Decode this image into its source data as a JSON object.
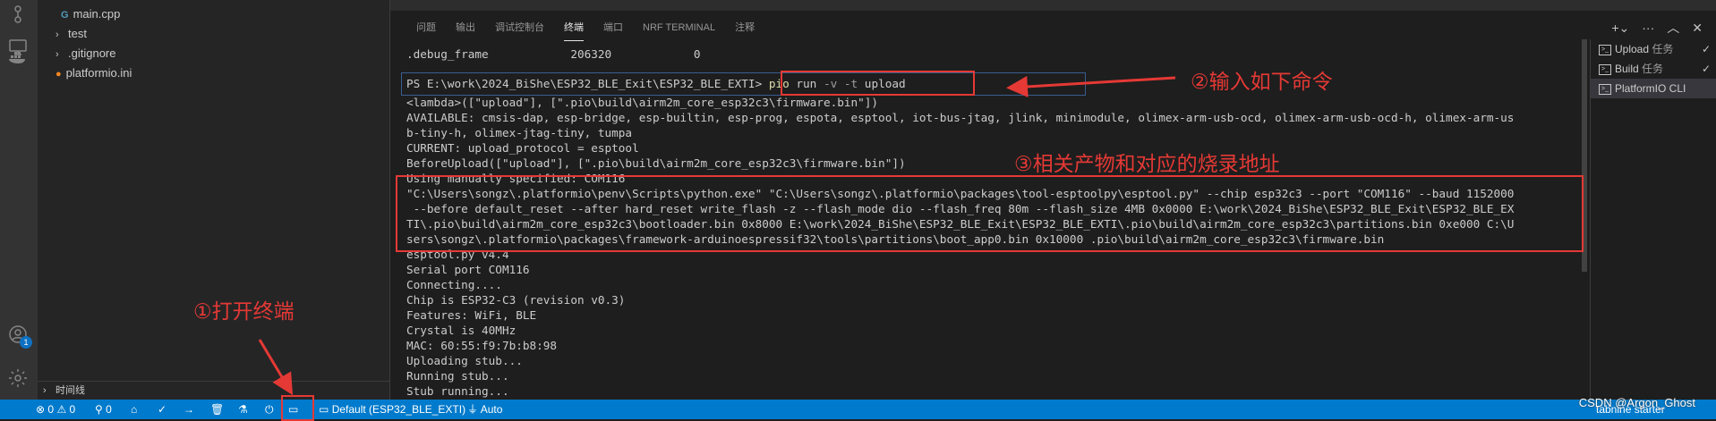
{
  "explorer": {
    "items": [
      {
        "label": "main.cpp",
        "icon": "cpp-file-icon"
      },
      {
        "label": "test",
        "icon": "folder-chevron-icon"
      },
      {
        "label": ".gitignore",
        "icon": "git-file-icon"
      },
      {
        "label": "platformio.ini",
        "icon": "platformio-file-icon"
      }
    ],
    "timeline_label": "时间线"
  },
  "activity": {
    "badge_count": "1"
  },
  "panel": {
    "tabs": [
      "问题",
      "输出",
      "调试控制台",
      "终端",
      "端口",
      "NRF TERMINAL",
      "注释"
    ],
    "active_tab": "终端"
  },
  "terminal": {
    "lines": [
      ".debug_frame            206320            0",
      "",
      "",
      "<lambda>([\"upload\"], [\".pio\\build\\airm2m_core_esp32c3\\firmware.bin\"])",
      "AVAILABLE: cmsis-dap, esp-bridge, esp-builtin, esp-prog, espota, esptool, iot-bus-jtag, jlink, minimodule, olimex-arm-usb-ocd, olimex-arm-usb-ocd-h, olimex-arm-us",
      "b-tiny-h, olimex-jtag-tiny, tumpa",
      "CURRENT: upload_protocol = esptool",
      "BeforeUpload([\"upload\"], [\".pio\\build\\airm2m_core_esp32c3\\firmware.bin\"])",
      "Using manually specified: COM116",
      "\"C:\\Users\\songz\\.platformio\\penv\\Scripts\\python.exe\" \"C:\\Users\\songz\\.platformio\\packages\\tool-esptoolpy\\esptool.py\" --chip esp32c3 --port \"COM116\" --baud 1152000",
      " --before default_reset --after hard_reset write_flash -z --flash_mode dio --flash_freq 80m --flash_size 4MB 0x0000 E:\\work\\2024_BiShe\\ESP32_BLE_Exit\\ESP32_BLE_EX",
      "TI\\.pio\\build\\airm2m_core_esp32c3\\bootloader.bin 0x8000 E:\\work\\2024_BiShe\\ESP32_BLE_Exit\\ESP32_BLE_EXTI\\.pio\\build\\airm2m_core_esp32c3\\partitions.bin 0xe000 C:\\U",
      "sers\\songz\\.platformio\\packages\\framework-arduinoespressif32\\tools\\partitions\\boot_app0.bin 0x10000 .pio\\build\\airm2m_core_esp32c3\\firmware.bin",
      "esptool.py v4.4",
      "Serial port COM116",
      "Connecting....",
      "Chip is ESP32-C3 (revision v0.3)",
      "Features: WiFi, BLE",
      "Crystal is 40MHz",
      "MAC: 60:55:f9:7b:b8:98",
      "Uploading stub...",
      "Running stub...",
      "Stub running..."
    ],
    "prompt": "PS E:\\work\\2024_BiShe\\ESP32_BLE_Exit\\ESP32_BLE_EXTI> ",
    "cmd": "pio",
    "cmd_args": " run ",
    "cmd_flags": "-v -t",
    "cmd_target": " upload"
  },
  "terminal_list": [
    {
      "label": "Upload",
      "suffix": "任务",
      "checked": true
    },
    {
      "label": "Build",
      "suffix": "任务",
      "checked": true
    },
    {
      "label": "PlatformIO CLI",
      "suffix": "",
      "checked": false
    }
  ],
  "statusbar": {
    "errors": "0",
    "warnings": "0",
    "ports": "0",
    "env": "Default (ESP32_BLE_EXTI)",
    "auto": "Auto",
    "tabnine": "tabnine starter"
  },
  "annotations": {
    "step1": "①打开终端",
    "step2": "②输入如下命令",
    "step3": "③相关产物和对应的烧录地址"
  },
  "watermark": "CSDN @Argon_Ghost",
  "colors": {
    "statusbar": "#007acc",
    "annotation": "#e53935",
    "accent": "#0e70c0"
  }
}
